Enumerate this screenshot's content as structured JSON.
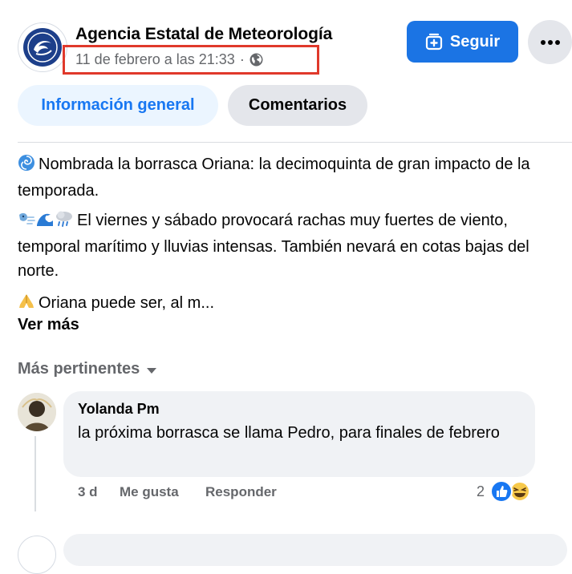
{
  "post": {
    "page_name": "Agencia Estatal de Meteorología",
    "timestamp": "11 de febrero a las 21:33",
    "separator": "·",
    "privacy_icon": "globe-icon",
    "follow_label": "Seguir",
    "follow_icon": "follow-plus-icon",
    "more_icon": "ellipsis-icon",
    "highlight_color": "#e0392b"
  },
  "tabs": [
    {
      "label": "Información general",
      "active": true
    },
    {
      "label": "Comentarios",
      "active": false
    }
  ],
  "content": {
    "para1": "Nombrada la borrasca Oriana: la decimoquinta de gran impacto de la temporada.",
    "para1_emoji": "cyclone-emoji",
    "para2": "El viernes y sábado provocará rachas muy fuertes de viento, temporal marítimo y lluvias intensas. También nevará en cotas bajas del norte.",
    "para2_emojis": [
      "wind-face-emoji",
      "water-wave-emoji",
      "rain-cloud-emoji"
    ],
    "para3": "Oriana puede ser, al m...",
    "para3_emoji": "folded-hands-emoji",
    "see_more": "Ver más"
  },
  "comments_section": {
    "sort_label": "Más pertinentes",
    "sort_icon": "caret-down-icon"
  },
  "comments": [
    {
      "author": "Yolanda Pm",
      "text": "la próxima borrasca se llama Pedro, para finales de febrero",
      "time": "3 d",
      "like_label": "Me gusta",
      "reply_label": "Responder",
      "reaction_count": "2",
      "reactions": [
        "like-reaction-icon",
        "haha-reaction-icon"
      ]
    }
  ],
  "colors": {
    "accent": "#1b74e4",
    "tab_active_bg": "#ebf5ff",
    "tab_active_text": "#1877f2",
    "secondary_text": "#65676b",
    "bubble_bg": "#f0f2f5"
  }
}
